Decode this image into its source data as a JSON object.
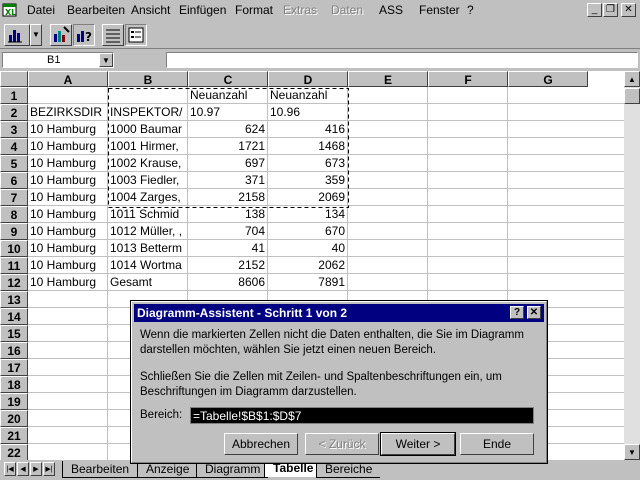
{
  "menubar": {
    "items": [
      {
        "label": "Datei",
        "enabled": true
      },
      {
        "label": "Bearbeiten",
        "enabled": true
      },
      {
        "label": "Ansicht",
        "enabled": true
      },
      {
        "label": "Einfügen",
        "enabled": true
      },
      {
        "label": "Format",
        "enabled": true
      },
      {
        "label": "Extras",
        "enabled": false
      },
      {
        "label": "Daten",
        "enabled": false
      },
      {
        "label": "ASS",
        "enabled": true
      },
      {
        "label": "Fenster",
        "enabled": true
      },
      {
        "label": "?",
        "enabled": true
      }
    ]
  },
  "formulabar": {
    "namebox": "B1",
    "formula": ""
  },
  "grid": {
    "columns": [
      "A",
      "B",
      "C",
      "D",
      "E",
      "F",
      "G"
    ],
    "rows": [
      "1",
      "2",
      "3",
      "4",
      "5",
      "6",
      "7",
      "8",
      "9",
      "10",
      "11",
      "12",
      "13",
      "14",
      "15",
      "16",
      "17",
      "18",
      "19",
      "20",
      "21",
      "22"
    ],
    "cells": {
      "r1": [
        "",
        "",
        "Neuanzahl",
        "Neuanzahl"
      ],
      "r2": [
        "BEZIRKSDIR",
        "INSPEKTOR/",
        "10.97",
        "10.96"
      ],
      "r3": [
        "10 Hamburg",
        "1000 Baumar",
        "624",
        "416"
      ],
      "r4": [
        "10 Hamburg",
        "1001 Hirmer,",
        "1721",
        "1468"
      ],
      "r5": [
        "10 Hamburg",
        "1002 Krause,",
        "697",
        "673"
      ],
      "r6": [
        "10 Hamburg",
        "1003 Fiedler,",
        "371",
        "359"
      ],
      "r7": [
        "10 Hamburg",
        "1004 Zarges,",
        "2158",
        "2069"
      ],
      "r8": [
        "10 Hamburg",
        "1011 Schmid",
        "138",
        "134"
      ],
      "r9": [
        "10 Hamburg",
        "1012 Müller, ,",
        "704",
        "670"
      ],
      "r10": [
        "10 Hamburg",
        "1013 Betterm",
        "41",
        "40"
      ],
      "r11": [
        "10 Hamburg",
        "1014 Wortma",
        "2152",
        "2062"
      ],
      "r12": [
        "10 Hamburg",
        "Gesamt",
        "8606",
        "7891"
      ]
    }
  },
  "sheet_tabs": [
    "Bearbeiten",
    "Anzeige",
    "Diagramm",
    "Tabelle",
    "Bereiche"
  ],
  "active_tab": "Tabelle",
  "dialog": {
    "title": "Diagramm-Assistent - Schritt 1 von 2",
    "text1_line1": "Wenn die markierten Zellen nicht die Daten enthalten, die Sie im Diagramm",
    "text1_line2": "darstellen möchten, wählen Sie jetzt einen neuen Bereich.",
    "text2_line1": "Schließen Sie die Zellen mit Zeilen- und Spaltenbeschriftungen ein, um",
    "text2_line2": "Beschriftungen im Diagramm darzustellen.",
    "range_label": "Bereich:",
    "range_value": "=Tabelle!$B$1:$D$7",
    "buttons": {
      "cancel": "Abbrechen",
      "back": "< Zurück",
      "next": "Weiter >",
      "finish": "Ende"
    },
    "help_glyph": "?",
    "close_glyph": "✕"
  },
  "window_buttons": {
    "minimize": "_",
    "restore": "❐",
    "close": "✕"
  }
}
